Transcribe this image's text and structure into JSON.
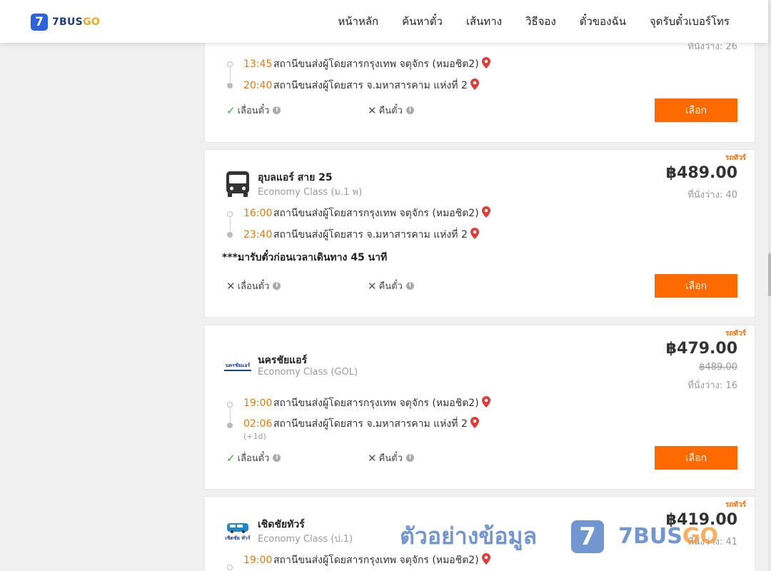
{
  "header": {
    "logo_number": "7",
    "logo_text_main": "7BUS",
    "logo_text_accent": "GO",
    "nav": [
      "หน้าหลัก",
      "ค้นหาตั๋ว",
      "เส้นทาง",
      "วิธีจอง",
      "ตั๋วของฉัน",
      "จุดรับตั๋วเบอร์โทร"
    ]
  },
  "trips": [
    {
      "seats": "ที่นั่งว่าง: 26",
      "depart_time": "13:45",
      "depart_station": "สถานีขนส่งผู้โดยสารกรุงเทพ จตุจักร (หมอชิต2)",
      "arrive_time": "20:40",
      "arrive_station": "สถานีขนส่งผู้โดยสาร จ.มหาสารคาม แห่งที่ 2",
      "reschedule": "เลื่อนตั๋ว",
      "refund": "คืนตั๋ว",
      "select": "เลือก"
    },
    {
      "tag": "รถทัวร์",
      "operator": "อุบลแอร์ สาย 25",
      "class": "Economy Class (ม.1 พ)",
      "price": "฿489.00",
      "seats": "ที่นั่งว่าง: 40",
      "depart_time": "16:00",
      "depart_station": "สถานีขนส่งผู้โดยสารกรุงเทพ จตุจักร (หมอชิต2)",
      "arrive_time": "23:40",
      "arrive_station": "สถานีขนส่งผู้โดยสาร จ.มหาสารคาม แห่งที่ 2",
      "note": "***มารับตั๋วก่อนเวลาเดินทาง 45 นาที",
      "reschedule": "เลื่อนตั๋ว",
      "refund": "คืนตั๋ว",
      "select": "เลือก"
    },
    {
      "tag": "รถทัวร์",
      "operator": "นครชัยแอร์",
      "class": "Economy Class (GOL)",
      "logo_text": "นครชัยแอร์",
      "price": "฿479.00",
      "old_price": "฿489.00",
      "seats": "ที่นั่งว่าง: 16",
      "depart_time": "19:00",
      "depart_station": "สถานีขนส่งผู้โดยสารกรุงเทพ จตุจักร (หมอชิต2)",
      "arrive_time": "02:06",
      "arrive_station": "สถานีขนส่งผู้โดยสาร จ.มหาสารคาม แห่งที่ 2",
      "next_day": "(+1d)",
      "reschedule": "เลื่อนตั๋ว",
      "refund": "คืนตั๋ว",
      "select": "เลือก"
    },
    {
      "tag": "รถทัวร์",
      "operator": "เชิดชัยทัวร์",
      "class": "Economy Class (ป.1)",
      "logo_text": "เชิดชัย ทัวร์",
      "price": "฿419.00",
      "seats": "ที่นั่งว่าง: 41",
      "depart_time": "19:00",
      "depart_station": "สถานีขนส่งผู้โดยสารกรุงเทพ จตุจักร (หมอชิต2)"
    }
  ],
  "watermark": {
    "text": "ตัวอย่างข้อมูล",
    "logo_number": "7",
    "brand_main": "7BUS",
    "brand_accent": "GO"
  },
  "colors": {
    "accent": "#ff6a00",
    "time": "#f07800",
    "brand": "#2b62e0",
    "ok": "#3aa83a",
    "pin": "#e53935"
  }
}
